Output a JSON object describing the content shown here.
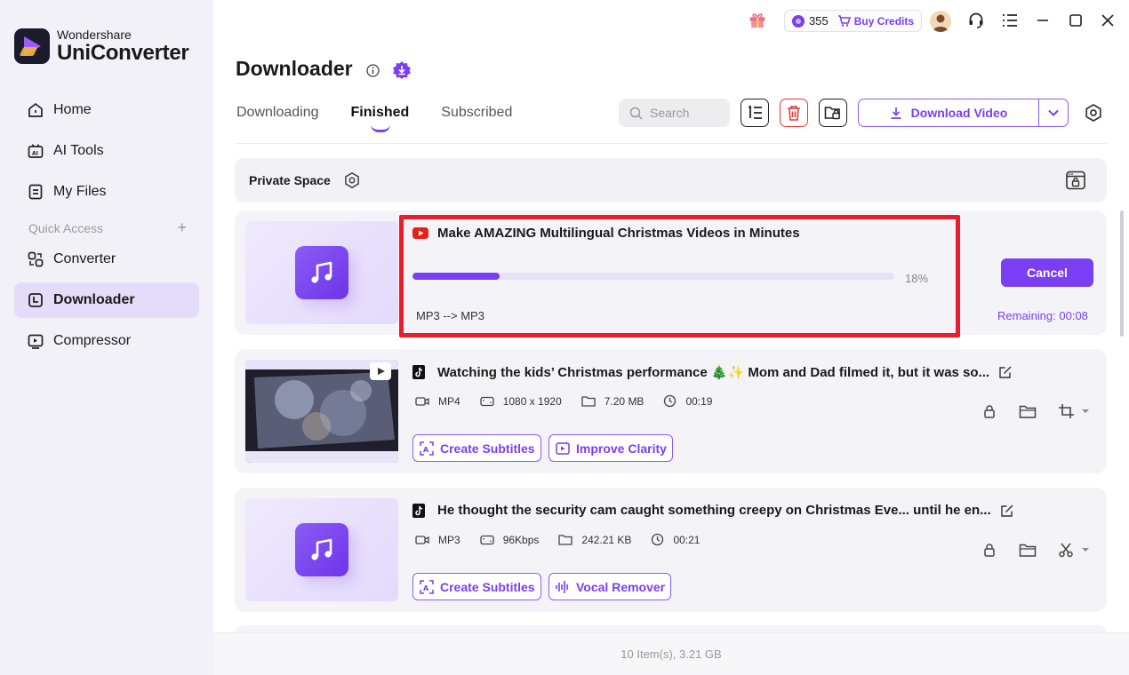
{
  "app": {
    "brand_small": "Wondershare",
    "brand_big": "UniConverter"
  },
  "sidebar": {
    "items": [
      {
        "label": "Home",
        "icon": "home-icon"
      },
      {
        "label": "AI Tools",
        "icon": "ai-tools-icon"
      },
      {
        "label": "My Files",
        "icon": "files-icon"
      }
    ],
    "quick_access_label": "Quick Access",
    "quick_items": [
      {
        "label": "Converter",
        "icon": "converter-icon"
      },
      {
        "label": "Downloader",
        "icon": "downloader-icon",
        "active": true
      },
      {
        "label": "Compressor",
        "icon": "compressor-icon"
      }
    ]
  },
  "topbar": {
    "credits": "355",
    "buy_label": "Buy Credits"
  },
  "page": {
    "title": "Downloader",
    "tabs": [
      "Downloading",
      "Finished",
      "Subscribed"
    ],
    "active_tab": "Finished",
    "search_placeholder": "Search",
    "download_button": "Download Video"
  },
  "private_space": {
    "label": "Private Space"
  },
  "downloading": {
    "title": "Make AMAZING Multilingual Christmas Videos in Minutes",
    "progress_percent": 18,
    "progress_label": "18%",
    "conversion": "MP3 --> MP3",
    "cancel_label": "Cancel",
    "remaining": "Remaining: 00:08"
  },
  "finished": [
    {
      "title": "Watching the kids’ Christmas performance 🎄✨ Mom and Dad filmed it, but it was so...",
      "format": "MP4",
      "resolution": "1080 x 1920",
      "size": "7.20 MB",
      "duration": "00:19",
      "actions": [
        "Create Subtitles",
        "Improve Clarity"
      ]
    },
    {
      "title": "He thought the security cam caught something creepy on Christmas Eve... until he en...",
      "format": "MP3",
      "resolution": "96Kbps",
      "size": "242.21 KB",
      "duration": "00:21",
      "actions": [
        "Create Subtitles",
        "Vocal Remover"
      ]
    }
  ],
  "footer": {
    "summary": "10 Item(s), 3.21 GB"
  },
  "colors": {
    "accent": "#7a3ff2",
    "highlight": "#e81e2a"
  }
}
